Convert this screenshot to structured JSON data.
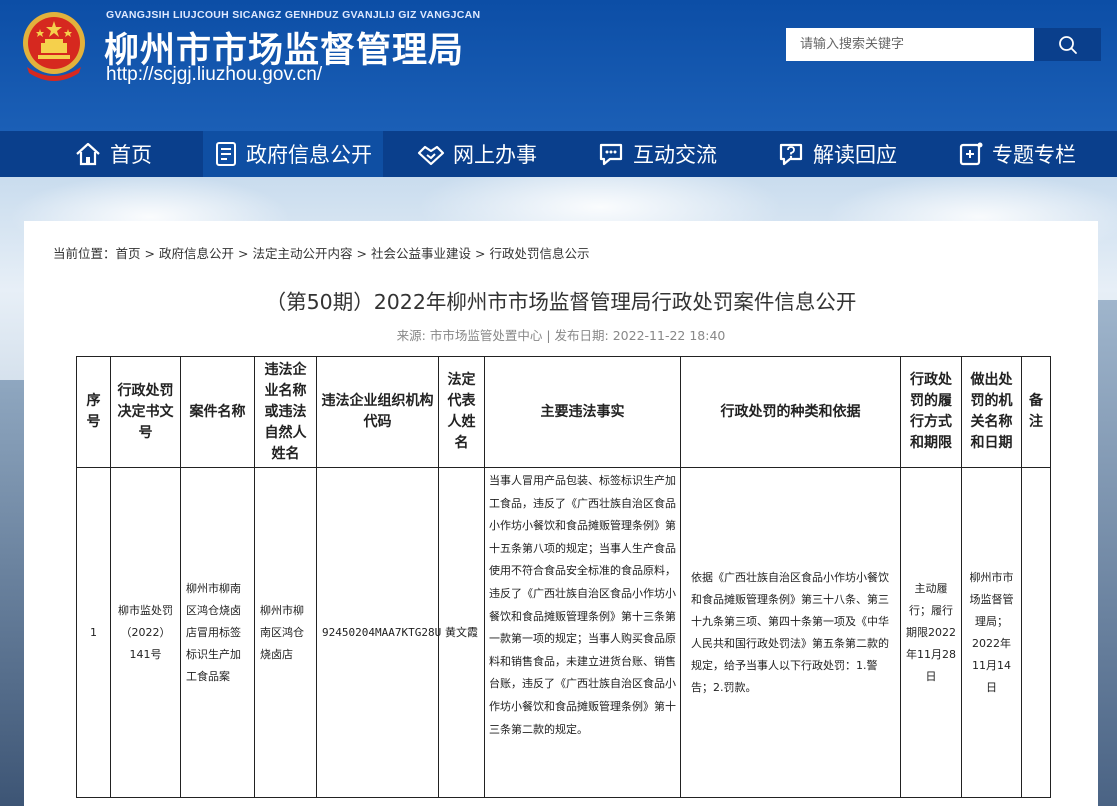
{
  "header": {
    "pinyin": "GVANGJSIH LIUJCOUH SICANGZ GENHDUZ GVANJLIJ GIZ VANGJCAN",
    "title": "柳州市市场监督管理局",
    "url": "http://scjgj.liuzhou.gov.cn/",
    "search_placeholder": "请输入搜索关键字"
  },
  "nav": {
    "items": [
      {
        "label": "首页",
        "icon": "home-icon"
      },
      {
        "label": "政府信息公开",
        "icon": "document-icon",
        "active": true
      },
      {
        "label": "网上办事",
        "icon": "handshake-icon"
      },
      {
        "label": "互动交流",
        "icon": "chat-icon"
      },
      {
        "label": "解读回应",
        "icon": "question-icon"
      },
      {
        "label": "专题专栏",
        "icon": "topic-icon"
      }
    ]
  },
  "breadcrumb": {
    "prefix": "当前位置：",
    "items": [
      "首页",
      "政府信息公开",
      "法定主动公开内容",
      "社会公益事业建设",
      "行政处罚信息公示"
    ],
    "separator": ">"
  },
  "article": {
    "title": "（第50期）2022年柳州市市场监督管理局行政处罚案件信息公开",
    "source_label": "来源:",
    "source": "市市场监管处置中心",
    "divider": "|",
    "date_label": "发布日期:",
    "date": "2022-11-22 18:40"
  },
  "table": {
    "headers": [
      "序号",
      "行政处罚决定书文号",
      "案件名称",
      "违法企业名称或违法自然人姓名",
      "违法企业组织机构代码",
      "法定代表人姓名",
      "主要违法事实",
      "行政处罚的种类和依据",
      "行政处罚的履行方式和期限",
      "做出处罚的机关名称和日期",
      "备注"
    ],
    "rows": [
      {
        "no": "1",
        "doc_no": "柳市监处罚（2022）141号",
        "case_name": "柳州市柳南区鸿仓烧卤店冒用标签标识生产加工食品案",
        "company": "柳州市柳南区鸿仓烧卤店",
        "org_code": "92450204MAA7KTG28U",
        "legal_rep": "黄文霞",
        "facts": "当事人冒用产品包装、标签标识生产加工食品，违反了《广西壮族自治区食品小作坊小餐饮和食品摊贩管理条例》第十五条第八项的规定；当事人生产食品使用不符合食品安全标准的食品原料，违反了《广西壮族自治区食品小作坊小餐饮和食品摊贩管理条例》第十三条第一款第一项的规定；当事人购买食品原料和销售食品，未建立进货台账、销售台账，违反了《广西壮族自治区食品小作坊小餐饮和食品摊贩管理条例》第十三条第二款的规定。",
        "basis": "依据《广西壮族自治区食品小作坊小餐饮和食品摊贩管理条例》第三十八条、第三十九条第三项、第四十条第一项及《中华人民共和国行政处罚法》第五条第二款的规定，给予当事人以下行政处罚：1.警告；2.罚款。",
        "execution": "主动履行；履行期限2022年11月28日",
        "authority": "柳州市市场监督管理局；2022年11月14日",
        "remark": ""
      }
    ]
  },
  "colors": {
    "header_blue": "#1b5fb6",
    "nav_blue": "#0a3f8c",
    "nav_active": "#0f4fa3"
  }
}
